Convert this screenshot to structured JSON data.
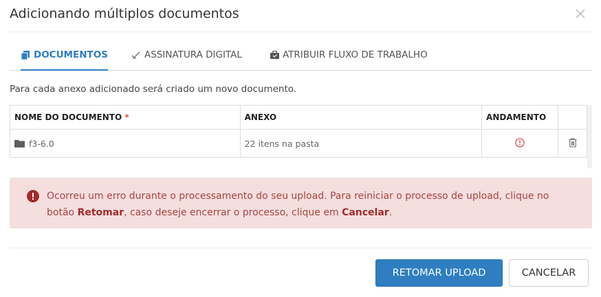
{
  "dialog": {
    "title": "Adicionando múltiplos documentos"
  },
  "tabs": [
    {
      "label": "DOCUMENTOS",
      "icon": "document-icon",
      "active": true
    },
    {
      "label": "ASSINATURA DIGITAL",
      "icon": "signature-icon",
      "active": false
    },
    {
      "label": "ATRIBUIR FLUXO DE TRABALHO",
      "icon": "workflow-briefcase-icon",
      "active": false
    }
  ],
  "info_text": "Para cada anexo adicionado será criado um novo documento.",
  "table": {
    "headers": {
      "name": "NOME DO DOCUMENTO",
      "required_mark": "*",
      "attachment": "ANEXO",
      "progress": "ANDAMENTO"
    },
    "rows": [
      {
        "name": "f3-6.0",
        "attachment": "22 itens na pasta",
        "status_icon": "error-circle-icon",
        "action_icon": "trash-icon"
      }
    ]
  },
  "alert": {
    "part1": "Ocorreu um erro durante o processamento do seu upload. Para reiniciar o processo de upload, clique no botão ",
    "strong1": "Retomar",
    "part2": ", caso deseje encerrar o processo, clique em ",
    "strong2": "Cancelar",
    "part3": ".",
    "color": "#a94442",
    "background": "#f4dede"
  },
  "buttons": {
    "resume": "RETOMAR UPLOAD",
    "cancel": "CANCELAR"
  },
  "colors": {
    "accent": "#2e7ec1",
    "error": "#d9534f"
  }
}
